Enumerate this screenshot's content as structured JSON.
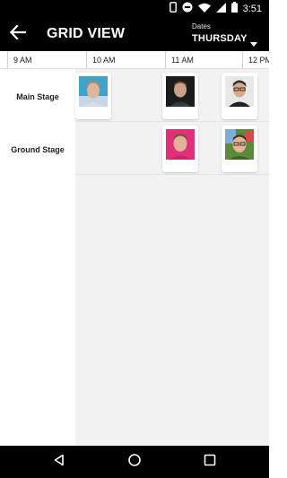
{
  "status_bar": {
    "time": "3:51",
    "icons": [
      "phone-icon",
      "do-not-disturb-icon",
      "wifi-icon",
      "signal-icon",
      "battery-icon"
    ]
  },
  "app_bar": {
    "back_icon": "arrow-back-icon",
    "title": "GRID VIEW",
    "dates_caption": "Dates",
    "dates_value": "THURSDAY",
    "dropdown_icon": "caret-down-icon"
  },
  "time_slots": [
    "9 AM",
    "10 AM",
    "11 AM",
    "12 PM"
  ],
  "rooms": [
    "Main Stage",
    "Ground Stage"
  ],
  "sessions": {
    "main_stage": [
      {
        "avatar": "speaker-avatar-1",
        "bg": "#3fa3c9"
      },
      {
        "avatar": "speaker-avatar-2",
        "bg": "#1c1c1c"
      },
      {
        "avatar": "speaker-avatar-3",
        "bg": "#e8e8e8"
      }
    ],
    "ground_stage": [
      {
        "avatar": "speaker-avatar-4",
        "bg": "#e0307a"
      },
      {
        "avatar": "speaker-avatar-5",
        "bg": "#5a8a3a"
      }
    ]
  },
  "nav_bar": {
    "icons": [
      "back-triangle-icon",
      "home-circle-icon",
      "recents-square-icon"
    ]
  },
  "colors": {
    "bar": "#000000",
    "grid_bg": "#f2f2f2",
    "card_bg": "#ffffff"
  }
}
